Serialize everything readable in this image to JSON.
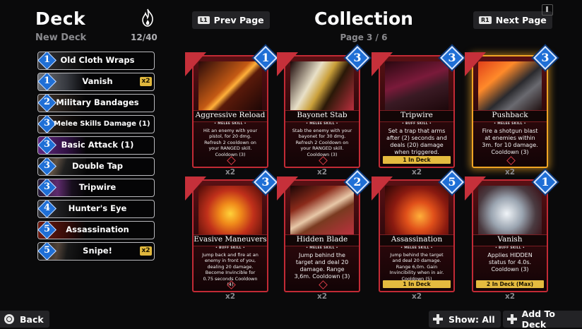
{
  "deck": {
    "title": "Deck",
    "name": "New Deck",
    "count": "12/40",
    "cards": [
      {
        "cost": "1",
        "name": "Old Cloth Wraps",
        "qty": ""
      },
      {
        "cost": "1",
        "name": "Vanish",
        "qty": "x2"
      },
      {
        "cost": "2",
        "name": "Military Bandages",
        "qty": ""
      },
      {
        "cost": "3",
        "name": "Melee Skills Damage (1)",
        "qty": ""
      },
      {
        "cost": "3",
        "name": "Basic Attack (1)",
        "qty": ""
      },
      {
        "cost": "3",
        "name": "Double Tap",
        "qty": ""
      },
      {
        "cost": "3",
        "name": "Tripwire",
        "qty": ""
      },
      {
        "cost": "4",
        "name": "Hunter's Eye",
        "qty": ""
      },
      {
        "cost": "5",
        "name": "Assassination",
        "qty": ""
      },
      {
        "cost": "5",
        "name": "Snipe!",
        "qty": "x2"
      }
    ]
  },
  "header": {
    "prev_tag": "L1",
    "prev_label": "Prev Page",
    "title": "Collection",
    "page": "Page 3 / 6",
    "next_tag": "R1",
    "next_label": "Next Page"
  },
  "cards": [
    {
      "cost": "1",
      "title": "Aggressive Reload",
      "subtitle": "• MELEE SKILL •",
      "desc": "Hit an enemy with your pistol, for 20 dmg. Refresh 2 cooldown on your RANGED skill. Cooldown (3)",
      "in_deck": "",
      "qty": "x2"
    },
    {
      "cost": "3",
      "title": "Bayonet Stab",
      "subtitle": "• MELEE SKILL •",
      "desc": "Stab the enemy with your bayonet for 30 dmg. Refresh 2 Cooldown on your RANGED skill. Cooldown (3)",
      "in_deck": "",
      "qty": "x2"
    },
    {
      "cost": "3",
      "title": "Tripwire",
      "subtitle": "• BUFF SKILL •",
      "desc": "Set a trap that arms after (2) seconds and deals (20) damage when triggered. Cooldown (4)",
      "in_deck": "1 In Deck",
      "qty": "x2"
    },
    {
      "cost": "3",
      "title": "Pushback",
      "subtitle": "• MELEE SKILL •",
      "desc": "Fire a shotgun blast at enemies within 3m. for 10 damage. Cooldown (3)",
      "in_deck": "",
      "qty": "x2"
    },
    {
      "cost": "3",
      "title": "Evasive Maneuvers",
      "subtitle": "• BUFF SKILL •",
      "desc": "Jump back and fire at an enemy in front of you, dealing 20 damage. Become Invincible for 0.75 seconds Cooldown (4)",
      "in_deck": "",
      "qty": "x2"
    },
    {
      "cost": "2",
      "title": "Hidden Blade",
      "subtitle": "• MELEE SKILL •",
      "desc": "Jump behind the target and deal 20 damage. Range 3,6m. Cooldown (3)",
      "in_deck": "",
      "qty": "x2"
    },
    {
      "cost": "5",
      "title": "Assassination",
      "subtitle": "• MELEE SKILL •",
      "desc": "Jump behind the target and deal 20 damage. Range 6,0m. Gain Invincibility when in air. Cooldown (5)",
      "in_deck": "1 In Deck",
      "qty": "x2"
    },
    {
      "cost": "1",
      "title": "Vanish",
      "subtitle": "• BUFF SKILL •",
      "desc": "Applies HIDDEN status for 4.0s. Cooldown (3)",
      "in_deck": "2 In Deck (Max)",
      "qty": "x2"
    }
  ],
  "footer": {
    "back_label": "Back",
    "show_label": "Show: All",
    "add_label": "Add To Deck"
  },
  "colors": {
    "card_border": "#c22a35",
    "gem_blue": "#1f6fd6",
    "in_deck_gold": "#e4bb3f",
    "selected_glow": "#f0a524"
  }
}
